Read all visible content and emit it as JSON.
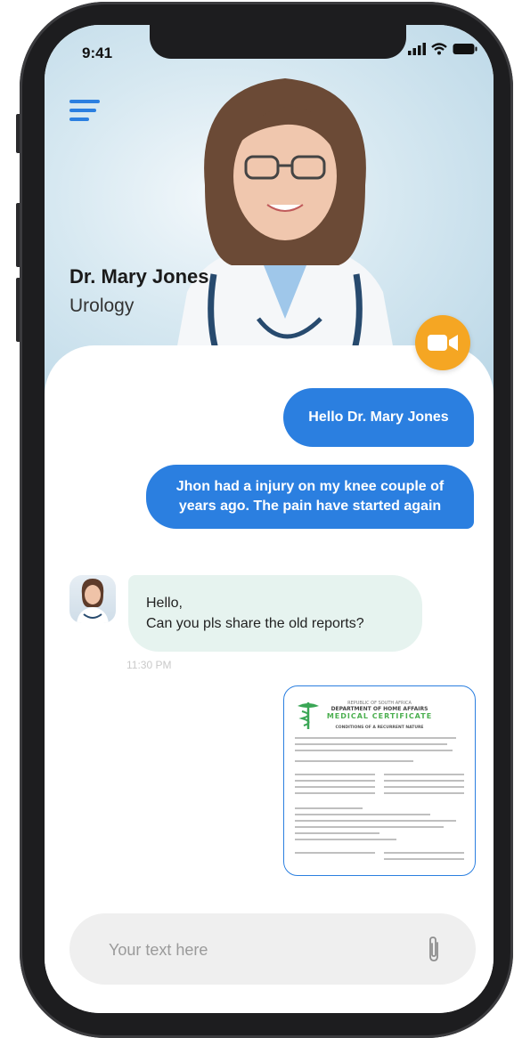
{
  "status_bar": {
    "time": "9:41"
  },
  "header": {
    "doctor_name": "Dr. Mary Jones",
    "specialty": "Urology",
    "menu_icon": "hamburger-icon",
    "video_icon": "video-camera-icon",
    "accent_color": "#2b7fe0",
    "video_button_color": "#f5a623"
  },
  "messages": [
    {
      "direction": "outgoing",
      "text": "Hello Dr. Mary Jones"
    },
    {
      "direction": "outgoing",
      "text": "Jhon had a injury on my knee couple of years ago. The pain  have started again"
    },
    {
      "direction": "incoming",
      "text": "Hello,\nCan you pls share the old reports?",
      "time": "11:30 PM"
    },
    {
      "direction": "outgoing",
      "type": "attachment",
      "document": {
        "line1": "REPUBLIC OF SOUTH AFRICA",
        "line2": "DEPARTMENT OF HOME AFFAIRS",
        "title": "MEDICAL CERTIFICATE",
        "heading": "CONDITIONS OF A RECURRENT NATURE"
      }
    }
  ],
  "composer": {
    "placeholder": "Your text here",
    "attach_icon": "paperclip-icon"
  }
}
